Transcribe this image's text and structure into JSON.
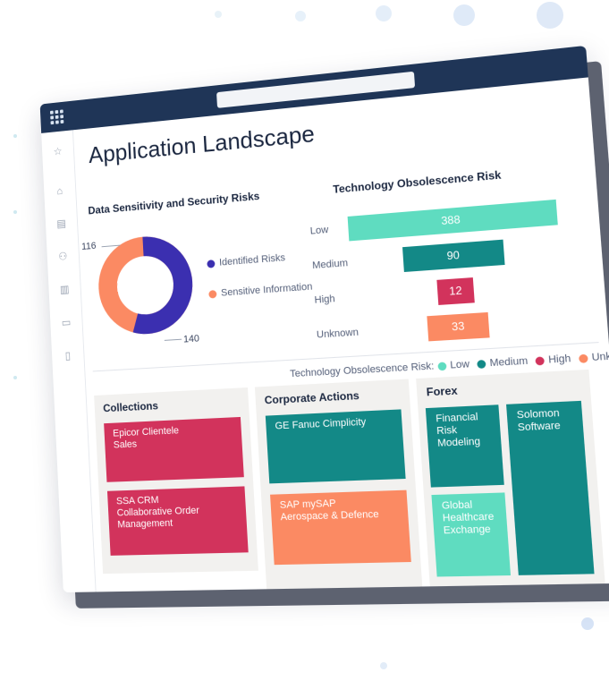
{
  "page": {
    "title": "Application Landscape"
  },
  "colors": {
    "titlebar": "#1f3557",
    "identified": "#3b2fb0",
    "sensitive": "#fb8a63",
    "low": "#5fdcc0",
    "medium": "#138987",
    "high": "#d2335c",
    "unknown": "#fb8a63"
  },
  "sidebar": {
    "icons": [
      "star-icon",
      "home-icon",
      "dashboard-icon",
      "people-icon",
      "library-icon",
      "document-icon",
      "report-icon"
    ]
  },
  "donut": {
    "title": "Data Sensitivity and Security Risks",
    "value_sensitive": "116",
    "value_identified": "140",
    "legend": {
      "identified": "Identified Risks",
      "sensitive": "Sensitive Information"
    }
  },
  "obsolescence": {
    "title": "Technology Obsolescence Risk",
    "bars": [
      {
        "label": "Low",
        "value": "388"
      },
      {
        "label": "Medium",
        "value": "90"
      },
      {
        "label": "High",
        "value": "12"
      },
      {
        "label": "Unknown",
        "value": "33"
      }
    ]
  },
  "risk_legend": {
    "title": "Technology Obsolescence Risk:",
    "low": "Low",
    "medium": "Medium",
    "high": "High",
    "unknown": "Unknown"
  },
  "panels": {
    "collections": {
      "title": "Collections",
      "tile1": "Epicor Clientele\nSales",
      "tile2": "SSA CRM\nCollaborative Order Management"
    },
    "corporate": {
      "title": "Corporate Actions",
      "tile1": "GE Fanuc Cimplicity",
      "tile2": "SAP mySAP\nAerospace & Defence"
    },
    "forex": {
      "title": "Forex",
      "tile1": "Financial Risk\nModeling",
      "tile2": "Solomon\nSoftware",
      "tile3": "Global\nHealthcare\nExchange"
    }
  },
  "chart_data": [
    {
      "type": "pie",
      "title": "Data Sensitivity and Security Risks",
      "categories": [
        "Identified Risks",
        "Sensitive Information"
      ],
      "values": [
        140,
        116
      ]
    },
    {
      "type": "bar",
      "title": "Technology Obsolescence Risk",
      "categories": [
        "Low",
        "Medium",
        "High",
        "Unknown"
      ],
      "values": [
        388,
        90,
        12,
        33
      ]
    }
  ]
}
